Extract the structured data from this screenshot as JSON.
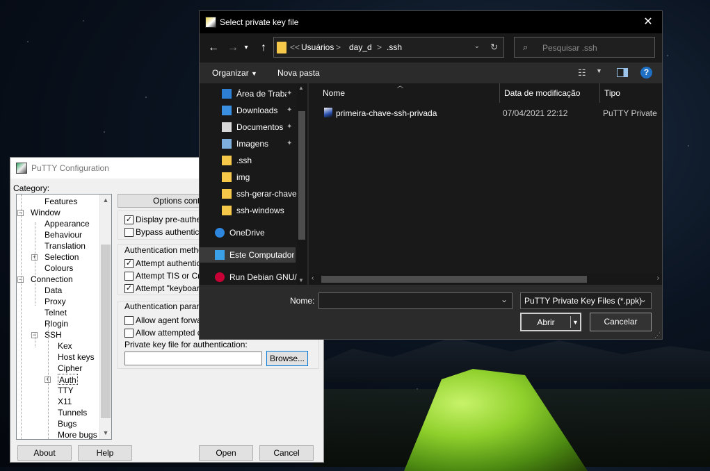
{
  "putty": {
    "title": "PuTTY Configuration",
    "category_label": "Category:",
    "tree": [
      {
        "label": "Features",
        "level": 2
      },
      {
        "label": "Window",
        "level": 1
      },
      {
        "label": "Appearance",
        "level": 2
      },
      {
        "label": "Behaviour",
        "level": 2
      },
      {
        "label": "Translation",
        "level": 2
      },
      {
        "label": "Selection",
        "level": 2
      },
      {
        "label": "Colours",
        "level": 2
      },
      {
        "label": "Connection",
        "level": 1
      },
      {
        "label": "Data",
        "level": 2
      },
      {
        "label": "Proxy",
        "level": 2
      },
      {
        "label": "Telnet",
        "level": 2
      },
      {
        "label": "Rlogin",
        "level": 2
      },
      {
        "label": "SSH",
        "level": 2
      },
      {
        "label": "Kex",
        "level": 3
      },
      {
        "label": "Host keys",
        "level": 3
      },
      {
        "label": "Cipher",
        "level": 3
      },
      {
        "label": "Auth",
        "level": 3
      },
      {
        "label": "TTY",
        "level": 3
      },
      {
        "label": "X11",
        "level": 3
      },
      {
        "label": "Tunnels",
        "level": 3
      },
      {
        "label": "Bugs",
        "level": 3
      },
      {
        "label": "More bugs",
        "level": 3
      }
    ],
    "options_header": "Options contro",
    "display_pre_auth": "Display pre-authent",
    "bypass_auth": "Bypass authenticati",
    "auth_methods_label": "Authentication methods",
    "attempt_auth": "Attempt authenticati",
    "attempt_tis": "Attempt TIS or Cryp",
    "attempt_keyboard": "Attempt \"keyboard-",
    "auth_params_label": "Authentication paramet",
    "allow_agent": "Allow agent forward",
    "allow_attempted": "Allow attempted ch",
    "private_key_label": "Private key file for authentication:",
    "private_key_value": "",
    "browse": "Browse...",
    "about": "About",
    "help": "Help",
    "open": "Open",
    "cancel": "Cancel"
  },
  "dialog": {
    "title": "Select private key file",
    "close_glyph": "✕",
    "breadcrumb": [
      "<<",
      "Usuários",
      ">",
      "day_d",
      ">",
      ".ssh"
    ],
    "search_placeholder": "Pesquisar .ssh",
    "organize": "Organizar",
    "new_folder": "Nova pasta",
    "nav_items": [
      {
        "label": "Área de Traba",
        "icon": "desktop-icon",
        "pinned": true
      },
      {
        "label": "Downloads",
        "icon": "download-icon",
        "pinned": true
      },
      {
        "label": "Documentos",
        "icon": "document-icon",
        "pinned": true
      },
      {
        "label": "Imagens",
        "icon": "image-icon",
        "pinned": true
      },
      {
        "label": ".ssh",
        "icon": "folder-icon",
        "pinned": false
      },
      {
        "label": "img",
        "icon": "folder-icon",
        "pinned": false
      },
      {
        "label": "ssh-gerar-chave",
        "icon": "folder-icon",
        "pinned": false
      },
      {
        "label": "ssh-windows",
        "icon": "folder-icon",
        "pinned": false
      },
      {
        "label": "OneDrive",
        "icon": "cloud-icon",
        "pinned": false
      },
      {
        "label": "Este Computador",
        "icon": "computer-icon",
        "pinned": false
      },
      {
        "label": "Run Debian GNU/",
        "icon": "debian-icon",
        "pinned": false
      }
    ],
    "columns": {
      "name": "Nome",
      "date": "Data de modificação",
      "type": "Tipo"
    },
    "files": [
      {
        "name": "primeira-chave-ssh-privada",
        "date": "07/04/2021 22:12",
        "type": "PuTTY Private Ke"
      }
    ],
    "filename_label": "Nome:",
    "filename_value": "",
    "filter": "PuTTY Private Key Files (*.ppk)",
    "open": "Abrir",
    "cancel": "Cancelar"
  }
}
